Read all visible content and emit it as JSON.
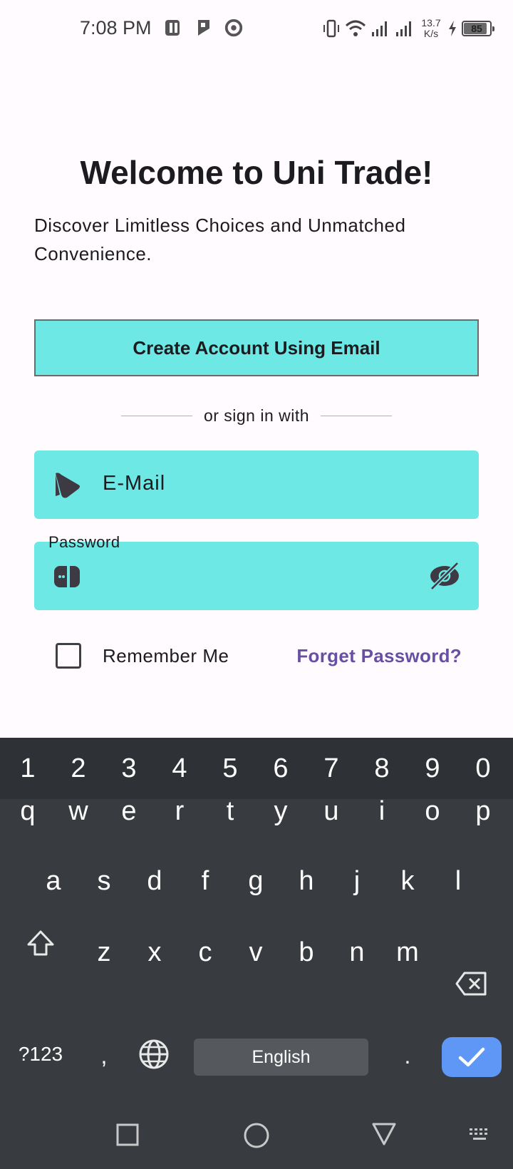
{
  "status_bar": {
    "time": "7:08 PM",
    "net_speed_value": "13.7",
    "net_speed_unit": "K/s",
    "battery": "85"
  },
  "main": {
    "title": "Welcome to Uni Trade!",
    "subtitle": "Discover Limitless Choices and Unmatched Convenience.",
    "create_account_label": "Create Account Using Email",
    "divider_text": "or sign in with",
    "email_placeholder": "E-Mail",
    "password_label": "Password",
    "remember_label": "Remember Me",
    "forget_label": "Forget Password?"
  },
  "keyboard": {
    "numbers": [
      "1",
      "2",
      "3",
      "4",
      "5",
      "6",
      "7",
      "8",
      "9",
      "0"
    ],
    "row1": [
      "q",
      "w",
      "e",
      "r",
      "t",
      "y",
      "u",
      "i",
      "o",
      "p"
    ],
    "row2": [
      "a",
      "s",
      "d",
      "f",
      "g",
      "h",
      "j",
      "k",
      "l"
    ],
    "row3": [
      "z",
      "x",
      "c",
      "v",
      "b",
      "n",
      "m"
    ],
    "symbols_label": "?123",
    "comma": ",",
    "period": ".",
    "space_label": "English"
  },
  "colors": {
    "accent": "#6de8e5",
    "link": "#6750a4",
    "keyboard_bg": "#383b40",
    "enter_key": "#5e97f6"
  }
}
